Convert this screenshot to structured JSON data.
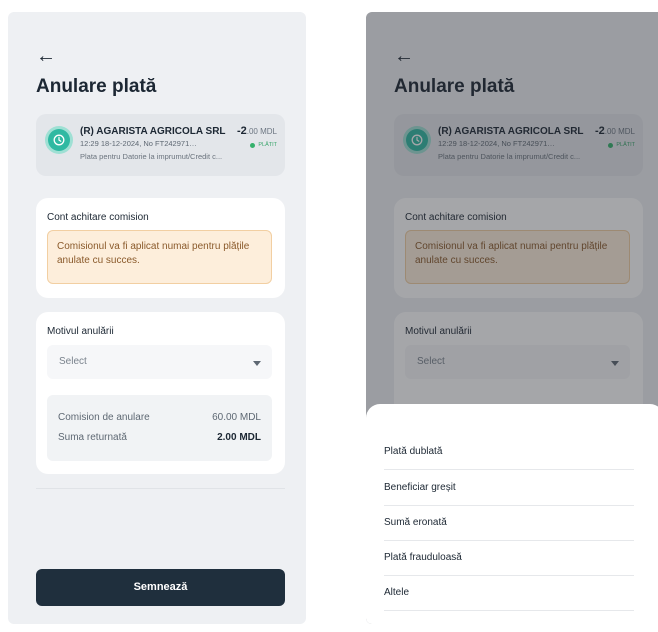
{
  "screen": {
    "back_icon": "arrow-left-icon",
    "title": "Anulare plată"
  },
  "transaction": {
    "avatar_icon": "clock-icon",
    "name": "(R) AGARISTA AGRICOLA SRL",
    "amount": "-2",
    "amount_decimals": ".00",
    "currency": "MDL",
    "meta": "12:29 18-12-2024, No FT2429712821...",
    "status": "PLĂTIT",
    "description": "Plata pentru Datorie la imprumut/Credit c...",
    "accent_color": "#2fb9a2"
  },
  "commission_account": {
    "label": "Cont achitare comision",
    "notice": "Comisionul va fi aplicat numai pentru plățile anulate cu succes."
  },
  "reason": {
    "label": "Motivul anulării",
    "placeholder": "Select",
    "fees": [
      {
        "label": "Comision de anulare",
        "value": "60.00 MDL"
      },
      {
        "label": "Suma returnată",
        "value": "2.00 MDL"
      }
    ]
  },
  "actions": {
    "sign": "Semnează"
  },
  "sheet": {
    "options": [
      "Plată dublată",
      "Beneficiar greșit",
      "Sumă eronată",
      "Plată frauduloasă",
      "Altele"
    ]
  }
}
